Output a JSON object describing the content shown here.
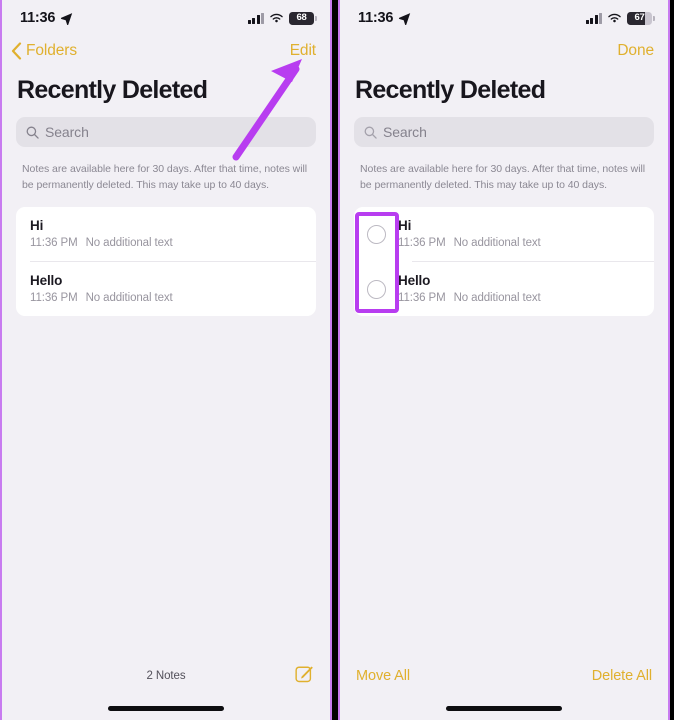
{
  "accent": "#e0b02e",
  "annotation_color": "#b83df0",
  "left_panel": {
    "status": {
      "time": "11:36",
      "location_icon": "location-arrow-icon",
      "signal_icon": "cellular-signal-icon",
      "wifi_icon": "wifi-icon",
      "battery_percent": "68"
    },
    "nav": {
      "back_label": "Folders",
      "back_icon": "chevron-left-icon",
      "action_label": "Edit"
    },
    "title": "Recently Deleted",
    "search": {
      "placeholder": "Search",
      "icon": "search-icon"
    },
    "description": "Notes are available here for 30 days. After that time, notes will be permanently deleted. This may take up to 40 days.",
    "notes": [
      {
        "title": "Hi",
        "time": "11:36 PM",
        "preview": "No additional text"
      },
      {
        "title": "Hello",
        "time": "11:36 PM",
        "preview": "No additional text"
      }
    ],
    "bottom": {
      "count_label": "2 Notes",
      "compose_icon": "compose-note-icon"
    }
  },
  "right_panel": {
    "status": {
      "time": "11:36",
      "location_icon": "location-arrow-icon",
      "signal_icon": "cellular-signal-icon",
      "wifi_icon": "wifi-icon",
      "battery_percent": "67"
    },
    "nav": {
      "action_label": "Done"
    },
    "title": "Recently Deleted",
    "search": {
      "placeholder": "Search",
      "icon": "search-icon"
    },
    "description": "Notes are available here for 30 days. After that time, notes will be permanently deleted. This may take up to 40 days.",
    "notes": [
      {
        "title": "Hi",
        "time": "11:36 PM",
        "preview": "No additional text"
      },
      {
        "title": "Hello",
        "time": "11:36 PM",
        "preview": "No additional text"
      }
    ],
    "bottom": {
      "move_label": "Move All",
      "delete_label": "Delete All"
    }
  }
}
